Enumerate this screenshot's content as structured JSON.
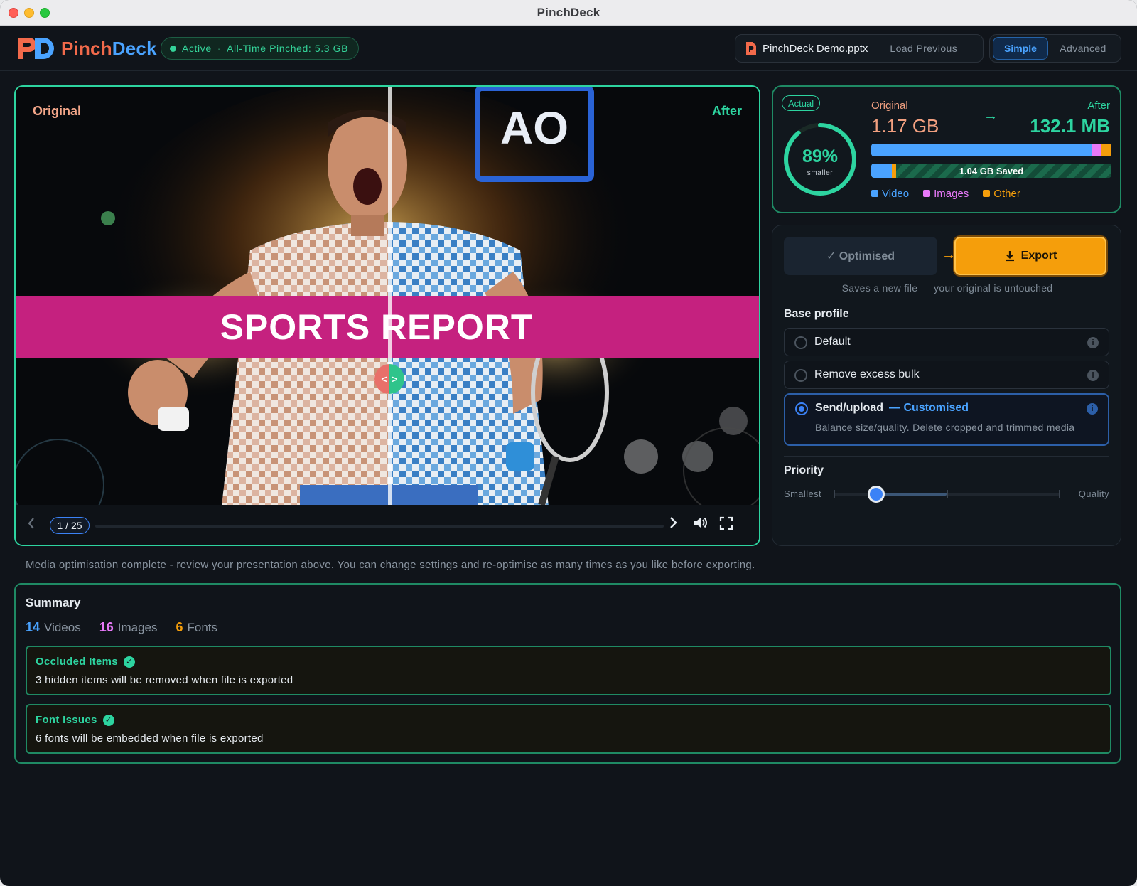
{
  "window": {
    "title": "PinchDeck"
  },
  "header": {
    "brand_first": "Pinch",
    "brand_second": "Deck",
    "status": {
      "state": "Active",
      "separator": "·",
      "pinched": "All-Time Pinched: 5.3 GB"
    },
    "file_name": "PinchDeck Demo.pptx",
    "load_previous": "Load Previous",
    "modes": {
      "simple": "Simple",
      "advanced": "Advanced",
      "selected": "Simple"
    }
  },
  "preview": {
    "label_original": "Original",
    "label_after": "After",
    "slide_title": "SPORTS REPORT",
    "logo_text": "AO",
    "page": "1 / 25",
    "split_position": 0.51
  },
  "stats": {
    "badge": "Actual",
    "percent": "89%",
    "percent_value": 0.89,
    "percent_sub": "smaller",
    "original_label": "Original",
    "after_label": "After",
    "original_value": "1.17 GB",
    "after_value": "132.1 MB",
    "saved_label": "1.04 GB Saved",
    "legend": [
      {
        "name": "Video",
        "color": "#4aa3ff"
      },
      {
        "name": "Images",
        "color": "#e879f9"
      },
      {
        "name": "Other",
        "color": "#f59e0b"
      }
    ],
    "original_breakdown": {
      "video": 0.92,
      "images": 0.035,
      "other": 0.045
    },
    "after_breakdown": {
      "video": 0.085,
      "images": 0.0,
      "other": 0.02
    }
  },
  "settings": {
    "optimised_label": "✓ Optimised",
    "export_label": "Export",
    "export_note": "Saves a new file — your original is untouched",
    "base_profile_title": "Base profile",
    "profiles": [
      {
        "label": "Default"
      },
      {
        "label": "Remove excess bulk"
      },
      {
        "label": "Send/upload",
        "tag": "— Customised",
        "description": "Balance size/quality. Delete cropped and trimmed media",
        "selected": true
      }
    ],
    "priority_title": "Priority",
    "priority_min": "Smallest",
    "priority_max": "Quality",
    "priority_value": 0.19
  },
  "status_line": "Media optimisation complete - review your presentation above. You can change settings and re-optimise as many times as you like before exporting.",
  "summary": {
    "title": "Summary",
    "videos_count": "14",
    "videos_label": "Videos",
    "images_count": "16",
    "images_label": "Images",
    "fonts_count": "6",
    "fonts_label": "Fonts",
    "issues": [
      {
        "title": "Occluded Items",
        "description": "3 hidden items will be removed when file is exported"
      },
      {
        "title": "Font Issues",
        "description": "6 fonts will be embedded when file is exported"
      }
    ]
  }
}
